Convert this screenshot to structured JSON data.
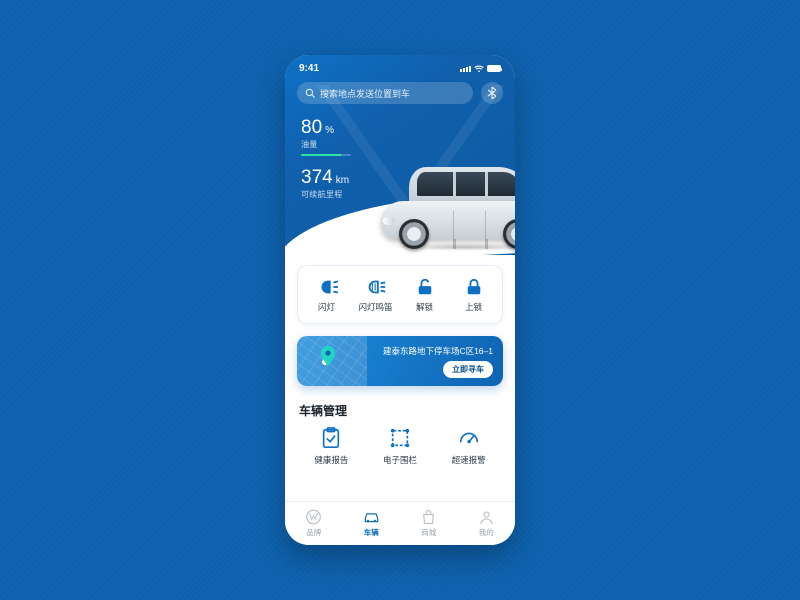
{
  "status": {
    "time": "9:41"
  },
  "search": {
    "placeholder": "搜索地点发送位置到车"
  },
  "hero": {
    "fuel_value": "80",
    "fuel_unit": "%",
    "fuel_label": "油量",
    "fuel_percent": 80,
    "range_value": "374",
    "range_unit": "km",
    "range_label": "可续航里程"
  },
  "quick_actions": [
    {
      "id": "flash",
      "label": "闪灯"
    },
    {
      "id": "flash-horn",
      "label": "闪灯鸣笛"
    },
    {
      "id": "unlock",
      "label": "解锁"
    },
    {
      "id": "lock",
      "label": "上锁"
    }
  ],
  "location": {
    "address": "建泰东路地下停车场C区16–1",
    "cta": "立即寻车"
  },
  "management": {
    "title": "车辆管理",
    "items": [
      {
        "id": "health",
        "label": "健康报告"
      },
      {
        "id": "geofence",
        "label": "电子围栏"
      },
      {
        "id": "speed",
        "label": "超速报警"
      }
    ]
  },
  "nav": [
    {
      "id": "brand",
      "label": "品牌",
      "active": false
    },
    {
      "id": "car",
      "label": "车辆",
      "active": true
    },
    {
      "id": "mall",
      "label": "商城",
      "active": false
    },
    {
      "id": "me",
      "label": "我的",
      "active": false
    }
  ]
}
